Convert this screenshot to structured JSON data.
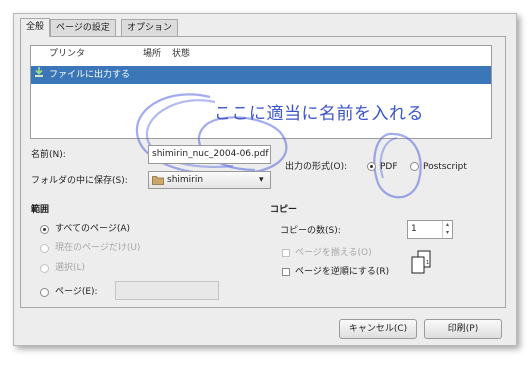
{
  "tabs": [
    "全般",
    "ページの設定",
    "オプション"
  ],
  "printer_list": {
    "columns": [
      "プリンタ",
      "場所",
      "状態"
    ],
    "rows": [
      {
        "name": "ファイルに出力する",
        "selected": true
      }
    ]
  },
  "annotation": "ここに適当に名前を入れる",
  "name_label": "名前(N):",
  "name_value": "shimirin_nuc_2004-06.pdf",
  "folder_label": "フォルダの中に保存(S):",
  "folder_value": "shimirin",
  "format_label": "出力の形式(O):",
  "format_options": [
    {
      "label": "PDF",
      "selected": true
    },
    {
      "label": "Postscript",
      "selected": false
    }
  ],
  "range": {
    "title": "範囲",
    "all": "すべてのページ(A)",
    "current": "現在のページだけ(U)",
    "selection": "選択(L)",
    "pages": "ページ(E):",
    "pages_value": ""
  },
  "copies": {
    "title": "コピー",
    "count_label": "コピーの数(S):",
    "count_value": "1",
    "collate": "ページを揃える(O)",
    "reverse": "ページを逆順にする(R)"
  },
  "buttons": {
    "cancel": "キャンセル(C)",
    "print": "印刷(P)"
  },
  "colors": {
    "selection": "#3a76b8",
    "annotation": "#3b53c9"
  }
}
